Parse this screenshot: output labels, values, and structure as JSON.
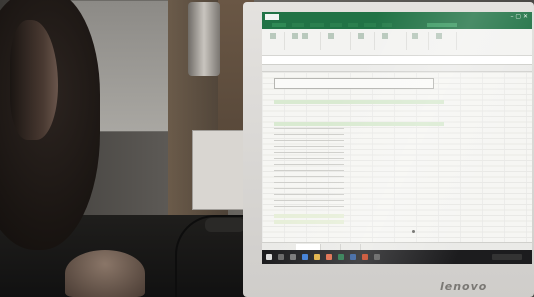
{
  "monitor": {
    "brand": "lenovo"
  },
  "spreadsheet": {
    "app_color": "#217346"
  }
}
